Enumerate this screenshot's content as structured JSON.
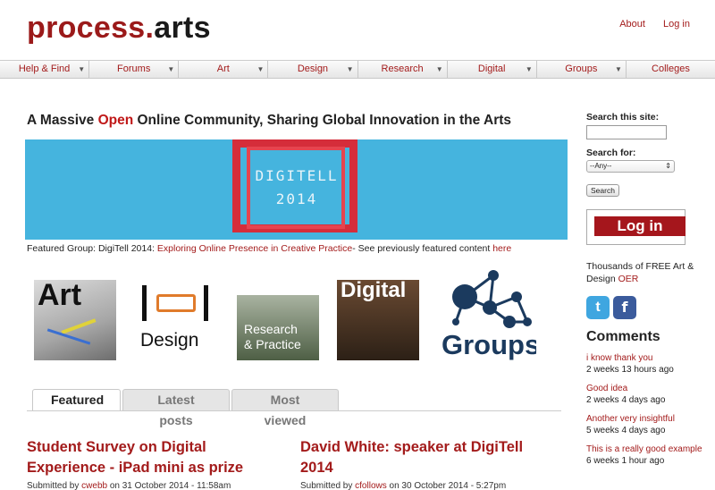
{
  "header": {
    "logo_part1": "process.",
    "logo_part2": "arts",
    "links": [
      "About",
      "Log in"
    ]
  },
  "nav": {
    "items": [
      {
        "label": "Help & Find",
        "arrow": "▼"
      },
      {
        "label": "Forums",
        "arrow": "▼"
      },
      {
        "label": "Art",
        "arrow": "▼"
      },
      {
        "label": "Design",
        "arrow": "▼"
      },
      {
        "label": "Research",
        "arrow": "▼"
      },
      {
        "label": "Digital",
        "arrow": "▼"
      },
      {
        "label": "Groups",
        "arrow": "▼"
      },
      {
        "label": "Colleges",
        "arrow": ""
      }
    ]
  },
  "main": {
    "headline_pre": "A Massive ",
    "headline_open": "Open",
    "headline_post": " Online Community, Sharing Global Innovation in the Arts",
    "banner_line1": "DIGITELL",
    "banner_line2": "2014",
    "featured_prefix": "Featured Group: DigiTell 2014: ",
    "featured_link": "Exploring Online Presence in Creative Practice",
    "featured_mid": "- See previously featured content ",
    "featured_here": "here",
    "tiles": {
      "art": "Art",
      "design": "Design",
      "research1": "Research",
      "research2": "& Practice",
      "digital": "Digital",
      "groups": "Groups"
    },
    "tabs": [
      "Featured",
      "Latest posts",
      "Most viewed"
    ],
    "posts": [
      {
        "title": "Student Survey on Digital Experience - iPad mini as prize",
        "submitted": "Submitted by ",
        "author": "cwebb",
        "date": " on 31 October 2014 - 11:58am"
      },
      {
        "title": "David White: speaker at DigiTell 2014",
        "submitted": "Submitted by ",
        "author": "cfollows",
        "date": " on 30 October 2014 - 5:27pm"
      }
    ]
  },
  "sidebar": {
    "search_label": "Search this site:",
    "search_value": "",
    "search_for_label": "Search for:",
    "select_value": "--Any--",
    "search_button": "Search",
    "login_button": "Log in",
    "free_text": "Thousands of FREE Art & Design ",
    "free_link": "OER",
    "twitter_glyph": "t",
    "facebook_glyph": "f",
    "comments_heading": "Comments",
    "comments": [
      {
        "title": "i know thank you",
        "time": "2 weeks 13 hours ago"
      },
      {
        "title": "Good idea",
        "time": "2 weeks 4 days ago"
      },
      {
        "title": "Another very insightful",
        "time": "5 weeks 4 days ago"
      },
      {
        "title": "This is a really good example",
        "time": "6 weeks 1 hour ago"
      }
    ]
  },
  "colors": {
    "brand_red": "#a31b1b",
    "banner_blue": "#45b4de",
    "login_red": "#a5161c"
  }
}
